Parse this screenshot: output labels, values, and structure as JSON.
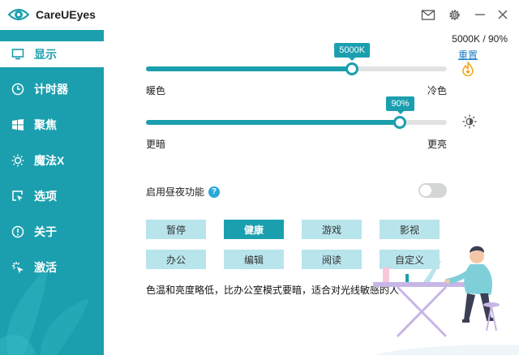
{
  "app": {
    "title": "CareUEyes"
  },
  "window_controls": {
    "mail": "mail-icon",
    "settings": "gear-icon",
    "minimize": "minimize-icon",
    "close": "close-icon"
  },
  "sidebar": {
    "items": [
      {
        "label": "显示",
        "icon": "monitor-icon",
        "active": true
      },
      {
        "label": "计时器",
        "icon": "clock-icon",
        "active": false
      },
      {
        "label": "聚焦",
        "icon": "windows-icon",
        "active": false
      },
      {
        "label": "魔法X",
        "icon": "sun-magic-icon",
        "active": false
      },
      {
        "label": "选项",
        "icon": "cursor-select-icon",
        "active": false
      },
      {
        "label": "关于",
        "icon": "info-icon",
        "active": false
      },
      {
        "label": "激活",
        "icon": "sparkle-icon",
        "active": false
      }
    ]
  },
  "status": "5000K / 90%",
  "reset_label": "重置",
  "temperature": {
    "value_label": "5000K",
    "fraction": 0.685,
    "left_label": "暖色",
    "right_label": "冷色"
  },
  "brightness": {
    "value_label": "90%",
    "fraction": 0.845,
    "left_label": "更暗",
    "right_label": "更亮"
  },
  "day_night": {
    "label": "启用昼夜功能",
    "help": "?",
    "enabled": false
  },
  "modes": [
    {
      "label": "暂停",
      "active": false
    },
    {
      "label": "健康",
      "active": true
    },
    {
      "label": "游戏",
      "active": false
    },
    {
      "label": "影视",
      "active": false
    },
    {
      "label": "办公",
      "active": false
    },
    {
      "label": "编辑",
      "active": false
    },
    {
      "label": "阅读",
      "active": false
    },
    {
      "label": "自定义",
      "active": false
    }
  ],
  "description": "色温和亮度略低，比办公室模式要暗，适合对光线敏感的人",
  "colors": {
    "accent": "#1b9fae",
    "mode_bg": "#b8e4ec",
    "link": "#1b7fc6"
  }
}
